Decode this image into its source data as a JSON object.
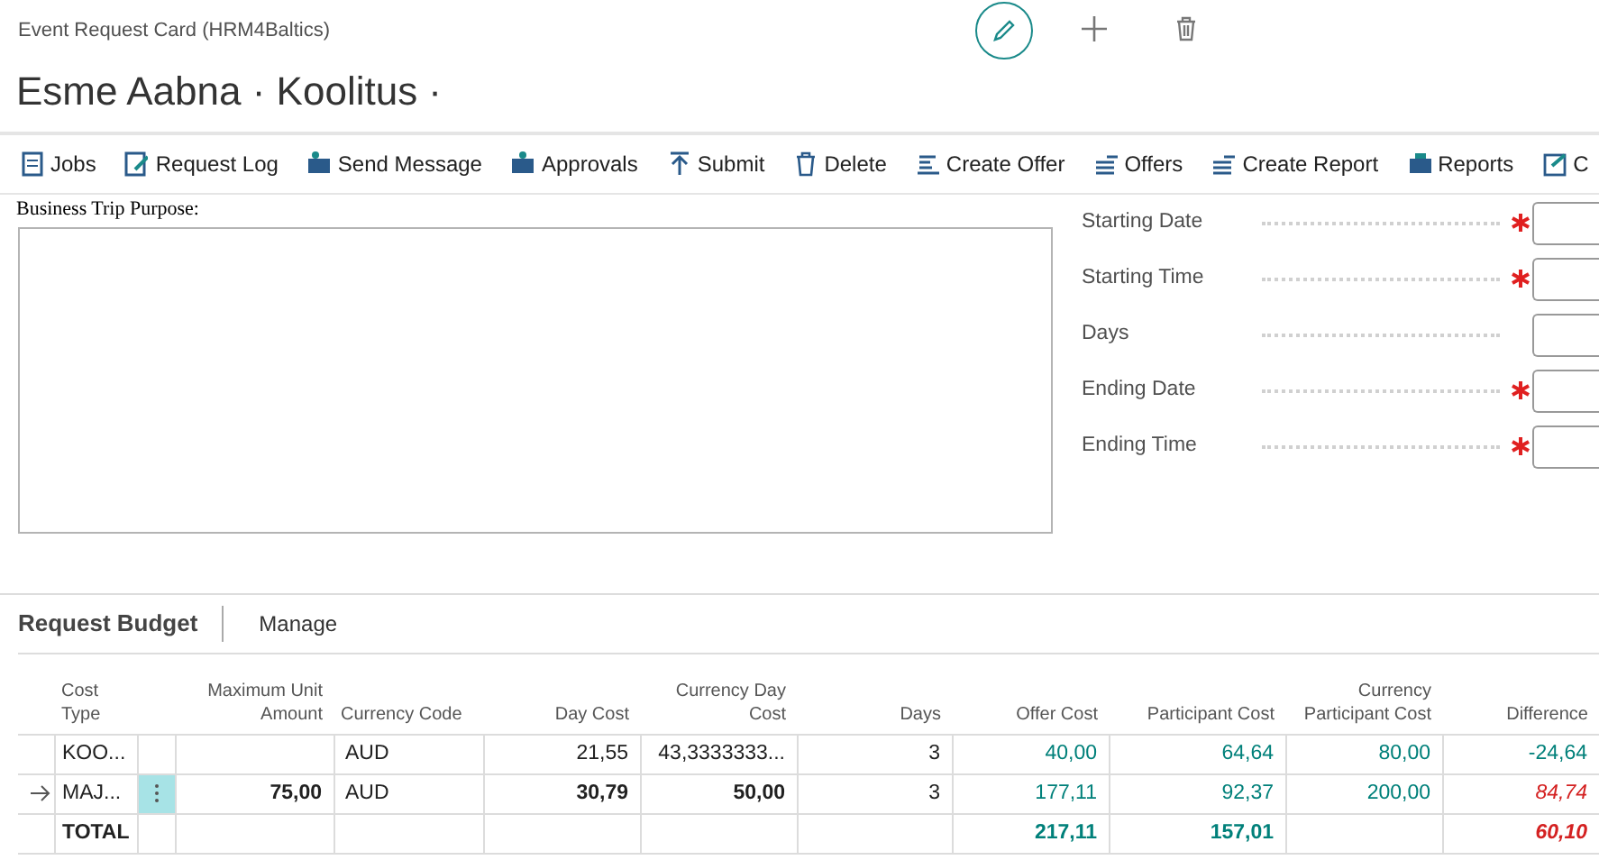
{
  "window": {
    "title": "Event Request Card (HRM4Baltics)"
  },
  "header_actions": [
    {
      "kind": "edit",
      "selected": true
    },
    {
      "kind": "new",
      "selected": false
    },
    {
      "kind": "delete",
      "selected": false
    }
  ],
  "page_title": "Esme Aabna · Koolitus ·",
  "actions": [
    {
      "label": "Jobs"
    },
    {
      "label": "Request Log"
    },
    {
      "label": "Send Message"
    },
    {
      "label": "Approvals"
    },
    {
      "label": "Submit"
    },
    {
      "label": "Delete"
    },
    {
      "label": "Create Offer"
    },
    {
      "label": "Offers"
    },
    {
      "label": "Create Report"
    },
    {
      "label": "Reports"
    },
    {
      "label": "C"
    }
  ],
  "purpose": {
    "label": "Business Trip Purpose:"
  },
  "fields": [
    {
      "label": "Starting Date",
      "required": true
    },
    {
      "label": "Starting Time",
      "required": true
    },
    {
      "label": "Days",
      "required": false
    },
    {
      "label": "Ending Date",
      "required": true
    },
    {
      "label": "Ending Time",
      "required": true
    }
  ],
  "budget": {
    "title": "Request Budget",
    "tabs": [
      {
        "label": "Manage"
      }
    ],
    "columns": [
      "Cost Type",
      "",
      "Maximum Unit Amount",
      "Currency Code",
      "Day Cost",
      "Currency Day Cost",
      "Days",
      "Offer Cost",
      "Participant Cost",
      "Currency Participant Cost",
      "Difference"
    ],
    "rows": [
      {
        "selected": false,
        "cells": [
          {
            "text": "KOO...",
            "kind": "plain"
          },
          {
            "text": "",
            "kind": "plain"
          },
          {
            "text": "",
            "kind": "plain"
          },
          {
            "text": "AUD",
            "kind": "plain"
          },
          {
            "text": "21,55",
            "kind": "plain"
          },
          {
            "text": "43,3333333...",
            "kind": "plain"
          },
          {
            "text": "3",
            "kind": "plain"
          },
          {
            "text": "40,00",
            "kind": "link"
          },
          {
            "text": "64,64",
            "kind": "link"
          },
          {
            "text": "80,00",
            "kind": "link"
          },
          {
            "text": "-24,64",
            "kind": "link"
          }
        ]
      },
      {
        "selected": true,
        "cells": [
          {
            "text": "MAJ...",
            "kind": "plain"
          },
          {
            "text": "",
            "kind": "plain"
          },
          {
            "text": "75,00",
            "kind": "bold"
          },
          {
            "text": "AUD",
            "kind": "plain"
          },
          {
            "text": "30,79",
            "kind": "bold"
          },
          {
            "text": "50,00",
            "kind": "bold"
          },
          {
            "text": "3",
            "kind": "plain"
          },
          {
            "text": "177,11",
            "kind": "link"
          },
          {
            "text": "92,37",
            "kind": "link"
          },
          {
            "text": "200,00",
            "kind": "link"
          },
          {
            "text": "84,74",
            "kind": "warn"
          }
        ]
      },
      {
        "selected": false,
        "cells": [
          {
            "text": "TOTAL",
            "kind": "bold"
          },
          {
            "text": "",
            "kind": "plain"
          },
          {
            "text": "",
            "kind": "plain"
          },
          {
            "text": "",
            "kind": "plain"
          },
          {
            "text": "",
            "kind": "plain"
          },
          {
            "text": "",
            "kind": "plain"
          },
          {
            "text": "",
            "kind": "plain"
          },
          {
            "text": "217,11",
            "kind": "link-bold"
          },
          {
            "text": "157,01",
            "kind": "link-bold"
          },
          {
            "text": "",
            "kind": "plain"
          },
          {
            "text": "60,10",
            "kind": "warn-bold"
          }
        ]
      }
    ]
  }
}
